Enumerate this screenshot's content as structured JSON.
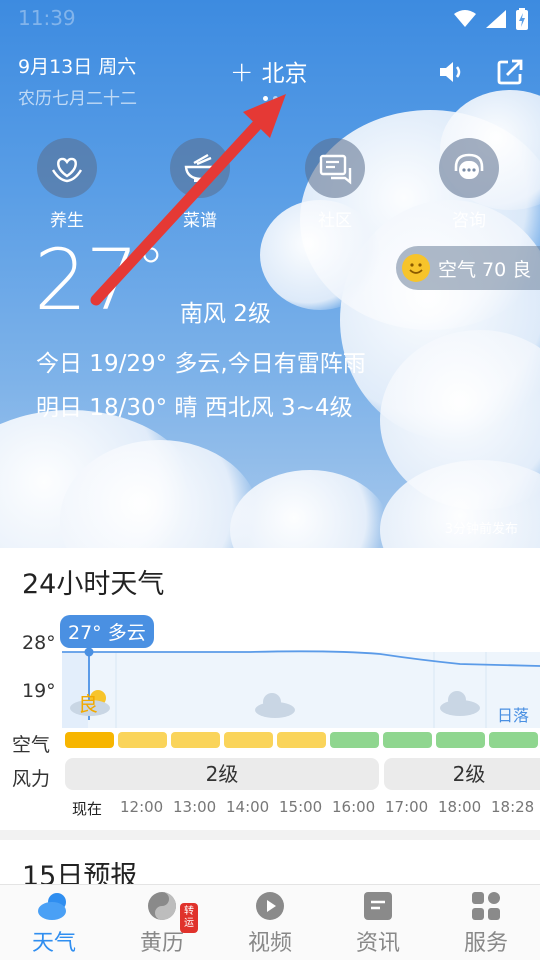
{
  "status": {
    "time": "11:39"
  },
  "header": {
    "date": "9月13日 周六",
    "lunar": "农历七月二十二",
    "add_symbol": "+",
    "city": "北京"
  },
  "services": [
    {
      "label": "养生",
      "icon": "lotus-hands-icon"
    },
    {
      "label": "菜谱",
      "icon": "bowl-icon"
    },
    {
      "label": "社区",
      "icon": "chat-bubbles-icon"
    },
    {
      "label": "咨询",
      "icon": "headset-icon"
    }
  ],
  "air_quality": {
    "label": "空气 70 良"
  },
  "current": {
    "temperature": "27",
    "degree": "°",
    "wind": "南风 2级",
    "today": "今日 19/29° 多云,今日有雷阵雨",
    "tomorrow": "明日 18/30° 晴 西北风 3~4级",
    "published": "3分钟前发布"
  },
  "hourly": {
    "title": "24小时天气",
    "y_labels": [
      "28°",
      "19°"
    ],
    "tooltip": "27° 多云",
    "aq_badge": "良",
    "sunset_label": "日落",
    "row_air": "空气",
    "row_wind": "风力",
    "wind_levels": [
      "2级",
      "2级"
    ],
    "times": [
      "现在",
      "12:00",
      "13:00",
      "14:00",
      "15:00",
      "16:00",
      "17:00",
      "18:00",
      "18:28"
    ],
    "aq_colors": [
      "#f7b500",
      "#fad45a",
      "#fad45a",
      "#fad45a",
      "#fad45a",
      "#8fd68f",
      "#8fd68f",
      "#8fd68f",
      "#8fd68f"
    ]
  },
  "forecast15": {
    "title": "15日预报"
  },
  "tabs": [
    {
      "label": "天气",
      "icon": "weather-icon",
      "active": true
    },
    {
      "label": "黄历",
      "icon": "yin-yang-icon",
      "badge": "转运"
    },
    {
      "label": "视频",
      "icon": "video-play-icon"
    },
    {
      "label": "资讯",
      "icon": "news-icon"
    },
    {
      "label": "服务",
      "icon": "grid-icon"
    }
  ],
  "colors": {
    "accent": "#2f8ef0",
    "annotation_arrow": "#e53935"
  }
}
